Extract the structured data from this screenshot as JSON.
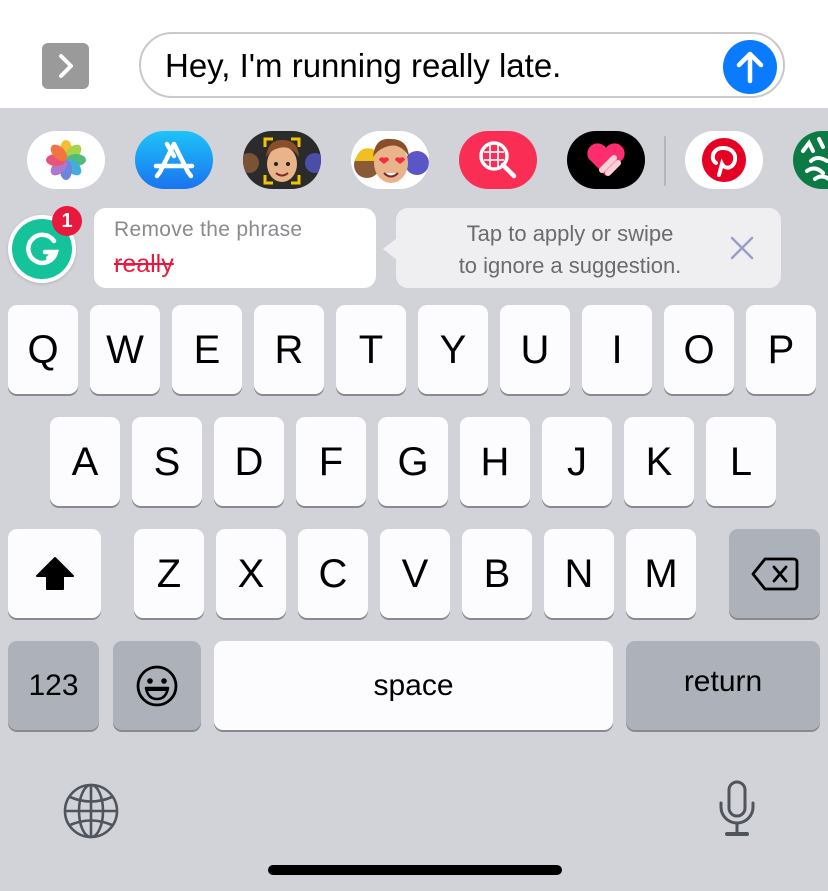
{
  "compose": {
    "expand_icon": "chevron-right-icon",
    "message_text": "Hey, I'm running really late.",
    "send_icon": "arrow-up-icon",
    "send_color": "#0a7aff"
  },
  "app_drawer": {
    "apps": [
      {
        "name": "Photos",
        "icon": "photos-icon"
      },
      {
        "name": "App Store",
        "icon": "app-store-icon"
      },
      {
        "name": "Memoji Stickers",
        "icon": "memoji-icon"
      },
      {
        "name": "Animoji",
        "icon": "animoji-icon"
      },
      {
        "name": "Images Search",
        "icon": "image-search-icon"
      },
      {
        "name": "Digital Touch",
        "icon": "heart-touch-icon"
      },
      {
        "name": "Pinterest",
        "icon": "pinterest-icon"
      },
      {
        "name": "Starbucks",
        "icon": "starbucks-icon"
      }
    ]
  },
  "grammarly": {
    "logo_letter": "G",
    "badge_count": "1",
    "brand_color": "#15c39a",
    "suggestion_title": "Remove the phrase",
    "suggestion_word": "really",
    "tip_line1": "Tap to apply or swipe",
    "tip_line2": "to ignore a suggestion."
  },
  "keyboard": {
    "row1": [
      "Q",
      "W",
      "E",
      "R",
      "T",
      "Y",
      "U",
      "I",
      "O",
      "P"
    ],
    "row2": [
      "A",
      "S",
      "D",
      "F",
      "G",
      "H",
      "J",
      "K",
      "L"
    ],
    "row3": [
      "Z",
      "X",
      "C",
      "V",
      "B",
      "N",
      "M"
    ],
    "numbers_label": "123",
    "space_label": "space",
    "return_label": "return"
  }
}
